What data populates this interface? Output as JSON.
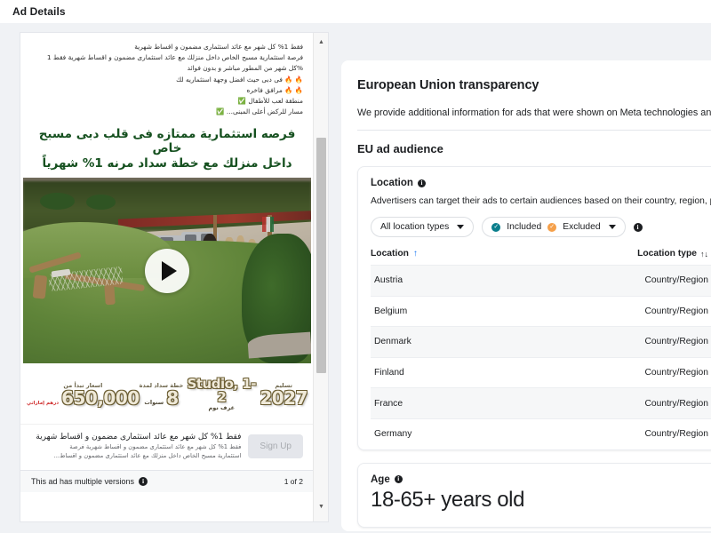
{
  "header": {
    "title": "Ad Details"
  },
  "ad": {
    "body_lines": [
      "فقط 1% كل شهر مع عائد استثمارى مضمون و اقساط شهرية",
      "فرصة استثمارية مسبح الخاص داخل منزلك مع عائد استثمارى مضمون و اقساط شهرية فقط 1",
      "%كل شهر من المطور مباشر و بدون فوائد",
      "🔥 🔥 فى دبى حيث افضل وجهة استثماريه لك",
      "🔥 🔥 مرافق فاخره",
      "منطقة لعب للأطفال",
      "مسار للركض أعلى المبنى..."
    ],
    "check_icon": "✅",
    "headline_line1": "فرصه استثمارية ممتازه فى قلب دبى مسبح خاص",
    "headline_line2": "داخل منزلك  مع خطة سداد مرنه 1% شهرياً",
    "media": {
      "type": "video",
      "play_icon": "play-triangle"
    },
    "banner": [
      {
        "label": "تسليم",
        "value": "2027",
        "sub": "",
        "currency": ""
      },
      {
        "label": "Studio, 1-2",
        "value": "",
        "sub": "غرف نوم",
        "currency": ""
      },
      {
        "label": "خطة سداد لمدة",
        "value": "8",
        "sub": "سنوات",
        "currency": ""
      },
      {
        "label": "اسعار تبدأ من",
        "value": "650,000",
        "sub": "",
        "currency": "درهم إماراتي"
      }
    ],
    "cta": {
      "title": "فقط 1% كل شهر مع عائد استثمارى مضمون و اقساط شهرية",
      "subtitle_line1": "فقط 1% كل شهر مع عائد استثمارى مضمون و اقساط شهرية فرصة",
      "subtitle_line2": "استثمارية مسبح الخاص داخل منزلك مع عائد استثمارى مضمون و اقساط...",
      "button_label": "Sign Up"
    },
    "versions": {
      "label": "This ad has multiple versions",
      "info_icon": "i",
      "count": "1 of 2"
    },
    "scrollbar": {
      "up_icon": "▲",
      "down_icon": "▼"
    }
  },
  "eu": {
    "title": "European Union transparency",
    "description": "We provide additional information for ads that were shown on Meta technologies anywhere",
    "subtitle": "EU ad audience",
    "location_card": {
      "heading": "Location",
      "info_icon": "i",
      "description": "Advertisers can target their ads to certain audiences based on their country, region, posta",
      "filters": {
        "location_type": "All location types",
        "included_label": "Included",
        "excluded_label": "Excluded",
        "check_icon": "✓",
        "info_icon": "i"
      },
      "columns": {
        "location": "Location",
        "location_sort_icon": "↑",
        "location_type": "Location type",
        "type_sort_icon": "↑↓"
      },
      "rows": [
        {
          "location": "Austria",
          "type": "Country/Region"
        },
        {
          "location": "Belgium",
          "type": "Country/Region"
        },
        {
          "location": "Denmark",
          "type": "Country/Region"
        },
        {
          "location": "Finland",
          "type": "Country/Region"
        },
        {
          "location": "France",
          "type": "Country/Region"
        },
        {
          "location": "Germany",
          "type": "Country/Region"
        }
      ]
    },
    "age_card": {
      "heading": "Age",
      "info_icon": "i",
      "value": "18-65+ years old"
    }
  },
  "colors": {
    "accent_blue": "#1877f2",
    "included_teal": "#0a7e8c",
    "excluded_orange": "#f5a04a",
    "headline_green": "#15501f",
    "currency_red": "#cf2b2b"
  }
}
